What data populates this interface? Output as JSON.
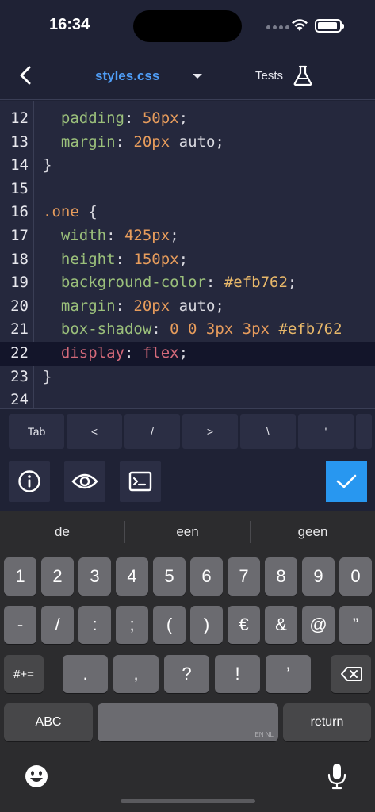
{
  "status_bar": {
    "time": "16:34"
  },
  "header": {
    "file_name": "styles.css",
    "tests_label": "Tests"
  },
  "editor": {
    "lines": [
      {
        "num": "12",
        "tokens": [
          {
            "t": "  ",
            "c": "plain"
          },
          {
            "t": "padding",
            "c": "prop"
          },
          {
            "t": ": ",
            "c": "plain"
          },
          {
            "t": "50px",
            "c": "num"
          },
          {
            "t": ";",
            "c": "plain"
          }
        ]
      },
      {
        "num": "13",
        "tokens": [
          {
            "t": "  ",
            "c": "plain"
          },
          {
            "t": "margin",
            "c": "prop"
          },
          {
            "t": ": ",
            "c": "plain"
          },
          {
            "t": "20px",
            "c": "num"
          },
          {
            "t": " auto;",
            "c": "plain"
          }
        ]
      },
      {
        "num": "14",
        "tokens": [
          {
            "t": "}",
            "c": "plain"
          }
        ]
      },
      {
        "num": "15",
        "tokens": []
      },
      {
        "num": "16",
        "tokens": [
          {
            "t": ".one",
            "c": "sel"
          },
          {
            "t": " {",
            "c": "plain"
          }
        ]
      },
      {
        "num": "17",
        "tokens": [
          {
            "t": "  ",
            "c": "plain"
          },
          {
            "t": "width",
            "c": "prop"
          },
          {
            "t": ": ",
            "c": "plain"
          },
          {
            "t": "425px",
            "c": "num"
          },
          {
            "t": ";",
            "c": "plain"
          }
        ]
      },
      {
        "num": "18",
        "tokens": [
          {
            "t": "  ",
            "c": "plain"
          },
          {
            "t": "height",
            "c": "prop"
          },
          {
            "t": ": ",
            "c": "plain"
          },
          {
            "t": "150px",
            "c": "num"
          },
          {
            "t": ";",
            "c": "plain"
          }
        ]
      },
      {
        "num": "19",
        "tokens": [
          {
            "t": "  ",
            "c": "plain"
          },
          {
            "t": "background-color",
            "c": "prop"
          },
          {
            "t": ": ",
            "c": "plain"
          },
          {
            "t": "#efb762",
            "c": "hex"
          },
          {
            "t": ";",
            "c": "plain"
          }
        ]
      },
      {
        "num": "20",
        "tokens": [
          {
            "t": "  ",
            "c": "plain"
          },
          {
            "t": "margin",
            "c": "prop"
          },
          {
            "t": ": ",
            "c": "plain"
          },
          {
            "t": "20px",
            "c": "num"
          },
          {
            "t": " auto;",
            "c": "plain"
          }
        ]
      },
      {
        "num": "21",
        "tokens": [
          {
            "t": "  ",
            "c": "plain"
          },
          {
            "t": "box-shadow",
            "c": "prop"
          },
          {
            "t": ": ",
            "c": "plain"
          },
          {
            "t": "0 0 3px 3px",
            "c": "num"
          },
          {
            "t": " ",
            "c": "plain"
          },
          {
            "t": "#efb762",
            "c": "hex"
          }
        ]
      },
      {
        "num": "22",
        "active": true,
        "tokens": [
          {
            "t": "  ",
            "c": "plain"
          },
          {
            "t": "display",
            "c": "kw"
          },
          {
            "t": ": ",
            "c": "plain"
          },
          {
            "t": "flex",
            "c": "kw"
          },
          {
            "t": ";",
            "c": "plain"
          }
        ]
      },
      {
        "num": "23",
        "tokens": [
          {
            "t": "}",
            "c": "plain"
          }
        ]
      },
      {
        "num": "24",
        "tokens": []
      }
    ]
  },
  "accessory_keys": [
    "Tab",
    "<",
    "/",
    ">",
    "\\",
    "'"
  ],
  "toolbar": {
    "info_icon": "info-icon",
    "preview_icon": "eye-icon",
    "console_icon": "terminal-icon",
    "confirm_icon": "checkmark-icon",
    "confirm_color": "#2897f0"
  },
  "keyboard": {
    "suggestions": [
      "de",
      "een",
      "geen"
    ],
    "row1": [
      "1",
      "2",
      "3",
      "4",
      "5",
      "6",
      "7",
      "8",
      "9",
      "0"
    ],
    "row2": [
      "-",
      "/",
      ":",
      ";",
      "(",
      ")",
      "€",
      "&",
      "@",
      "”"
    ],
    "row3_left": "#+=",
    "row3": [
      ".",
      ",",
      "?",
      "!",
      "’"
    ],
    "abc": "ABC",
    "space_lang": "EN NL",
    "return": "return",
    "emoji_icon": "emoji-icon",
    "mic_icon": "microphone-icon",
    "backspace_icon": "backspace-icon"
  },
  "colors": {
    "background": "#1f2235",
    "editor_bg": "#25283d",
    "accent": "#4f9ef7"
  }
}
